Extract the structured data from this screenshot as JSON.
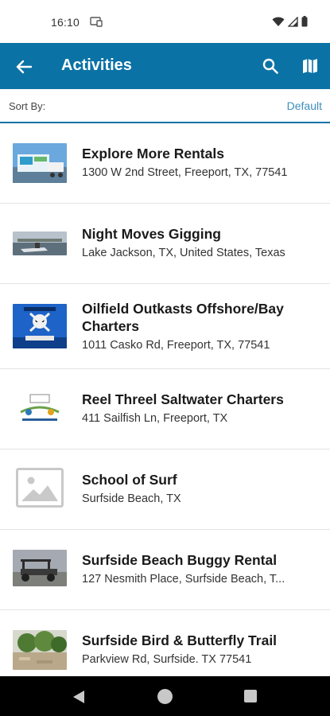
{
  "status_bar": {
    "time": "16:10"
  },
  "app_bar": {
    "title": "Activities"
  },
  "sort": {
    "label": "Sort By:",
    "value": "Default"
  },
  "items": [
    {
      "title": "Explore More Rentals",
      "address": "1300 W 2nd Street, Freeport, TX, 77541"
    },
    {
      "title": "Night Moves Gigging",
      "address": "Lake Jackson, TX, United States, Texas"
    },
    {
      "title": "Oilfield Outkasts Offshore/Bay Charters",
      "address": "1011 Casko Rd, Freeport, TX, 77541"
    },
    {
      "title": "Reel Threel Saltwater Charters",
      "address": "411 Sailfish Ln, Freeport, TX"
    },
    {
      "title": "School of Surf",
      "address": "Surfside Beach, TX"
    },
    {
      "title": "Surfside Beach Buggy Rental",
      "address": "127 Nesmith Place, Surfside Beach, T..."
    },
    {
      "title": "Surfside Bird & Butterfly Trail",
      "address": "Parkview Rd, Surfside. TX 77541"
    }
  ],
  "colors": {
    "primary": "#0b72a6",
    "link": "#3c8fbe"
  }
}
